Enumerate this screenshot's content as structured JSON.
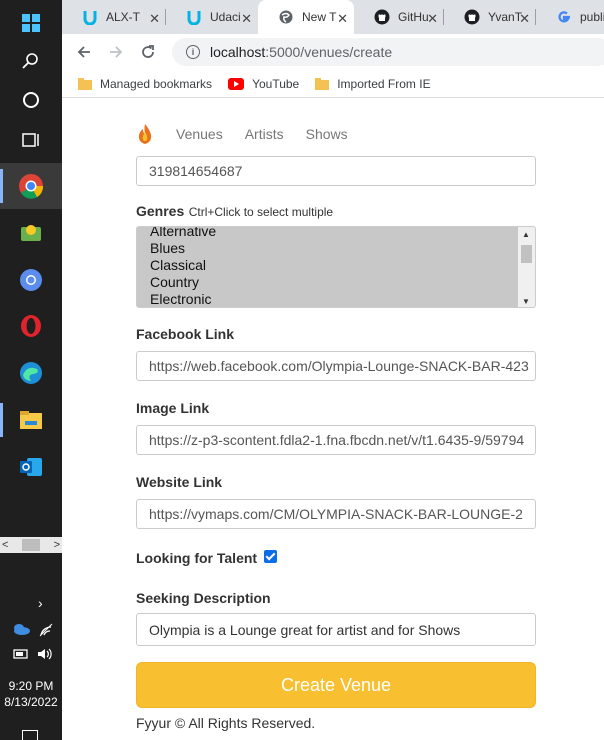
{
  "taskbar": {
    "clock_time": "9:20 PM",
    "clock_date": "8/13/2022"
  },
  "tabs": [
    {
      "title": "ALX-T",
      "icon": "udacity-icon"
    },
    {
      "title": "Udaci",
      "icon": "udacity-icon"
    },
    {
      "title": "New T",
      "icon": "globe-icon"
    },
    {
      "title": "GitHu",
      "icon": "github-icon"
    },
    {
      "title": "YvanT",
      "icon": "github-icon"
    },
    {
      "title": "publi",
      "icon": "google-icon"
    }
  ],
  "address": {
    "host": "localhost",
    "path": ":5000/venues/create"
  },
  "bookmarks": [
    {
      "label": "Managed bookmarks"
    },
    {
      "label": "YouTube"
    },
    {
      "label": "Imported From IE"
    }
  ],
  "nav": {
    "venues": "Venues",
    "artists": "Artists",
    "shows": "Shows"
  },
  "form": {
    "phone_value": "319814654687",
    "genres_label": "Genres",
    "genres_hint": "Ctrl+Click to select multiple",
    "genres_options": [
      "Alternative",
      "Blues",
      "Classical",
      "Country",
      "Electronic"
    ],
    "facebook_label": "Facebook Link",
    "facebook_value": "https://web.facebook.com/Olympia-Lounge-SNACK-BAR-423",
    "image_label": "Image Link",
    "image_value": "https://z-p3-scontent.fdla2-1.fna.fbcdn.net/v/t1.6435-9/59794",
    "website_label": "Website Link",
    "website_value": "https://vymaps.com/CM/OLYMPIA-SNACK-BAR-LOUNGE-2",
    "talent_label": "Looking for Talent",
    "seeking_label": "Seeking Description",
    "seeking_value": "Olympia is a Lounge great for artist and for Shows",
    "submit_label": "Create Venue"
  },
  "footer": "Fyyur © All Rights Reserved.",
  "colors": {
    "button": "#f8c030",
    "select_bg": "#c8c8c8",
    "checkbox": "#0b6ee6"
  }
}
